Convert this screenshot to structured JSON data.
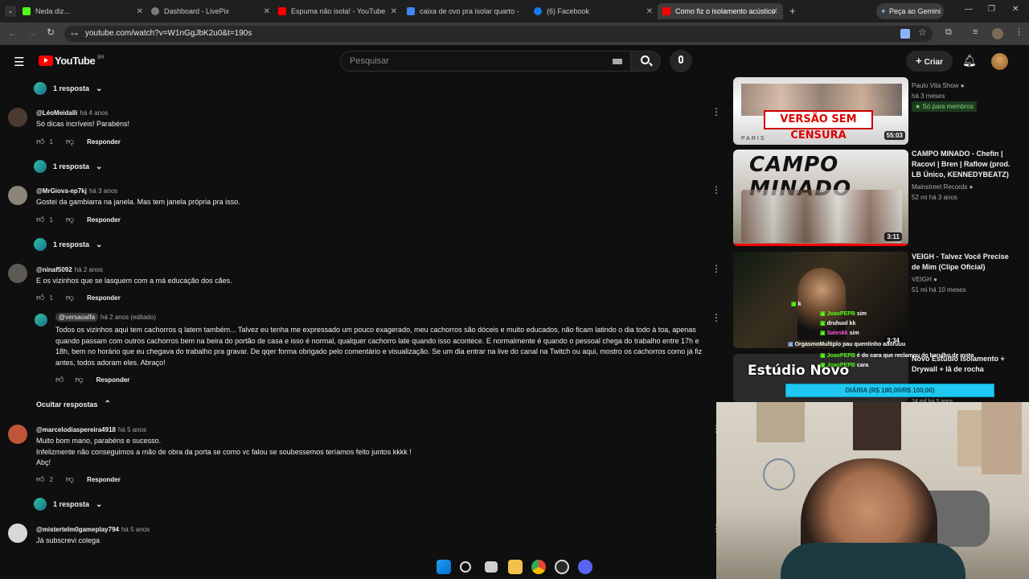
{
  "tabs": [
    {
      "label": "Neda diz...",
      "color": "#53fc18"
    },
    {
      "label": "Dashboard - LivePix",
      "color": "#7a7a7a"
    },
    {
      "label": "Espuma não isola! - YouTube",
      "color": "#ff0000"
    },
    {
      "label": "caixa de ovo pra isolar quarto -",
      "color": "#4285f4"
    },
    {
      "label": "(6) Facebook",
      "color": "#1877f2"
    },
    {
      "label": "Como fiz o isolamento acústico",
      "color": "#ff0000"
    }
  ],
  "gemini_button": "Peça ao Gemini",
  "address": {
    "url": "youtube.com/watch?v=W1nGgJbK2u0&t=190s"
  },
  "youtube": {
    "logo": "YouTube",
    "region": "BR",
    "search_placeholder": "Pesquisar",
    "create_label": "Criar"
  },
  "comments": [
    {
      "replies_label": "1 resposta"
    },
    {
      "handle": "@LéoMeidalli",
      "time": "há 4 anos",
      "text": "Só dicas incríveis! Parabéns!",
      "likes": "1",
      "reply": "Responder",
      "replies_label": "1 resposta"
    },
    {
      "handle": "@MrGiova-ep7kj",
      "time": "há 3 anos",
      "text": "Gostei da gambiarra na janela.  Mas tem janela própria pra isso.",
      "likes": "1",
      "reply": "Responder",
      "replies_label": "1 resposta"
    },
    {
      "handle": "@ninaf5092",
      "time": "há 2 anos",
      "text": "E os vizinhos que se lasquem com a má educação dos cães.",
      "likes": "1",
      "reply": "Responder"
    },
    {
      "handle": "@versaoalfa",
      "time": "há 2 anos (editado)",
      "text": "Todos os vizinhos aqui tem cachorros q latem também... Talvez eu tenha me  expressado um pouco exagerado, meu cachorros são dóceis e muito educados, não ficam latindo o dia todo à toa, apenas\nquando passam com outros cachorros bem na beira do portão de casa e isso é normal, qualquer cachorro late quando isso acontece. E normalmente é quando o pessoal chega do trabalho entre 17h e\n18h,  bem no horário que eu chegava do trabalho pra gravar. De qqer forma obrigado pelo comentário e visualização. Se um dia entrar na live do canal na Twitch ou aqui, mostro os cachorros como já fiz\nantes, todos adoram eles. Abraço!",
      "reply": "Responder"
    },
    {
      "hide_replies": "Ocultar respostas"
    },
    {
      "handle": "@marcelodiaspereira4918",
      "time": "há 5 anos",
      "text": "Muito bom mano, parabéns e sucesso.\nInfelizmente não conseguimos a mão de obra da porta se como vc falou se soubessemos teríamos feito juntos kkkk !\nAbç!",
      "likes": "2",
      "reply": "Responder",
      "replies_label": "1 resposta"
    },
    {
      "handle": "@misterteIm0gameplay794",
      "time": "há 5 anos",
      "text": "Já subscrevi colega"
    }
  ],
  "related": [
    {
      "thumb_text": "VERSÃO SEM CENSURA",
      "thumb_sub": "PARIS",
      "duration": "55:03",
      "channel": "Paulo Vita Show",
      "meta": "há 3 meses",
      "badge": "Só para membros"
    },
    {
      "thumb_text": "CAMPO MINADO",
      "duration": "3:11",
      "title": "CAMPO MINADO - Chefin | Racovi | Bren | Raflow (prod. LB Único, KENNEDYBEATZ)",
      "channel": "Mainstreet Records",
      "meta": "52 mi  há 3 anos"
    },
    {
      "duration": "3:34",
      "title": "VEIGH - Talvez Você Precise de Mim (Clipe Oficial)",
      "channel": "VEIGH",
      "meta": "51 mi  há 10 meses"
    },
    {
      "title": "Novo Estúdio Isolamento + Drywall + lã de rocha",
      "meta": "24 mil  há 5 anos"
    }
  ],
  "stream_overlay": {
    "chat": [
      {
        "user": "",
        "msg": "k",
        "color": "#53fc18"
      },
      {
        "user": "JoaoPEPB",
        "msg": "sim",
        "color": "#53fc18"
      },
      {
        "user": "",
        "msg": "druhuol kk",
        "color": "#ff5fd2"
      },
      {
        "user": "Saleskk",
        "msg": "sim",
        "color": "#ff5fd2"
      },
      {
        "user": "OrgasmoMultiplo",
        "msg": "pau quentinho adoruuu",
        "color": "#ffffff"
      },
      {
        "user": "JoaoPEPB",
        "msg": "é do cara que reclamou do barulho de moto",
        "color": "#53fc18"
      },
      {
        "user": "JoaoPEPB",
        "msg": "cara",
        "color": "#53fc18"
      }
    ],
    "title": "Estúdio Novo",
    "goal": "DIÁRIA (R$ 180,00/R$ 100,00)"
  }
}
